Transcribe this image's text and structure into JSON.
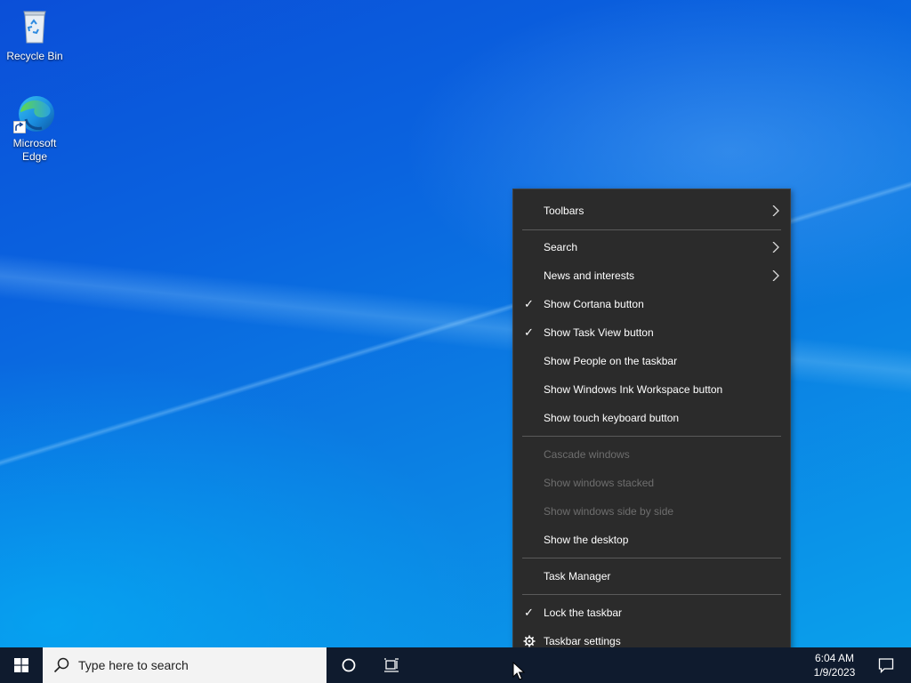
{
  "desktop": {
    "icons": [
      {
        "label": "Recycle Bin",
        "icon": "recycle-bin-icon"
      },
      {
        "label": "Microsoft Edge",
        "icon": "edge-icon"
      }
    ]
  },
  "context_menu": {
    "items": [
      {
        "label": "Toolbars",
        "submenu": true
      },
      {
        "label": "Search",
        "submenu": true
      },
      {
        "label": "News and interests",
        "submenu": true
      },
      {
        "label": "Show Cortana button",
        "checked": true
      },
      {
        "label": "Show Task View button",
        "checked": true
      },
      {
        "label": "Show People on the taskbar"
      },
      {
        "label": "Show Windows Ink Workspace button"
      },
      {
        "label": "Show touch keyboard button"
      },
      {
        "label": "Cascade windows",
        "disabled": true
      },
      {
        "label": "Show windows stacked",
        "disabled": true
      },
      {
        "label": "Show windows side by side",
        "disabled": true
      },
      {
        "label": "Show the desktop"
      },
      {
        "label": "Task Manager"
      },
      {
        "label": "Lock the taskbar",
        "checked": true
      },
      {
        "label": "Taskbar settings",
        "icon": "gear-icon"
      }
    ]
  },
  "taskbar": {
    "search_placeholder": "Type here to search",
    "time": "6:04 AM",
    "date": "1/9/2023"
  },
  "colors": {
    "menu_bg": "#2b2b2b",
    "taskbar_bg": "#0f1b2e",
    "disabled_text": "#6e6e6e"
  }
}
